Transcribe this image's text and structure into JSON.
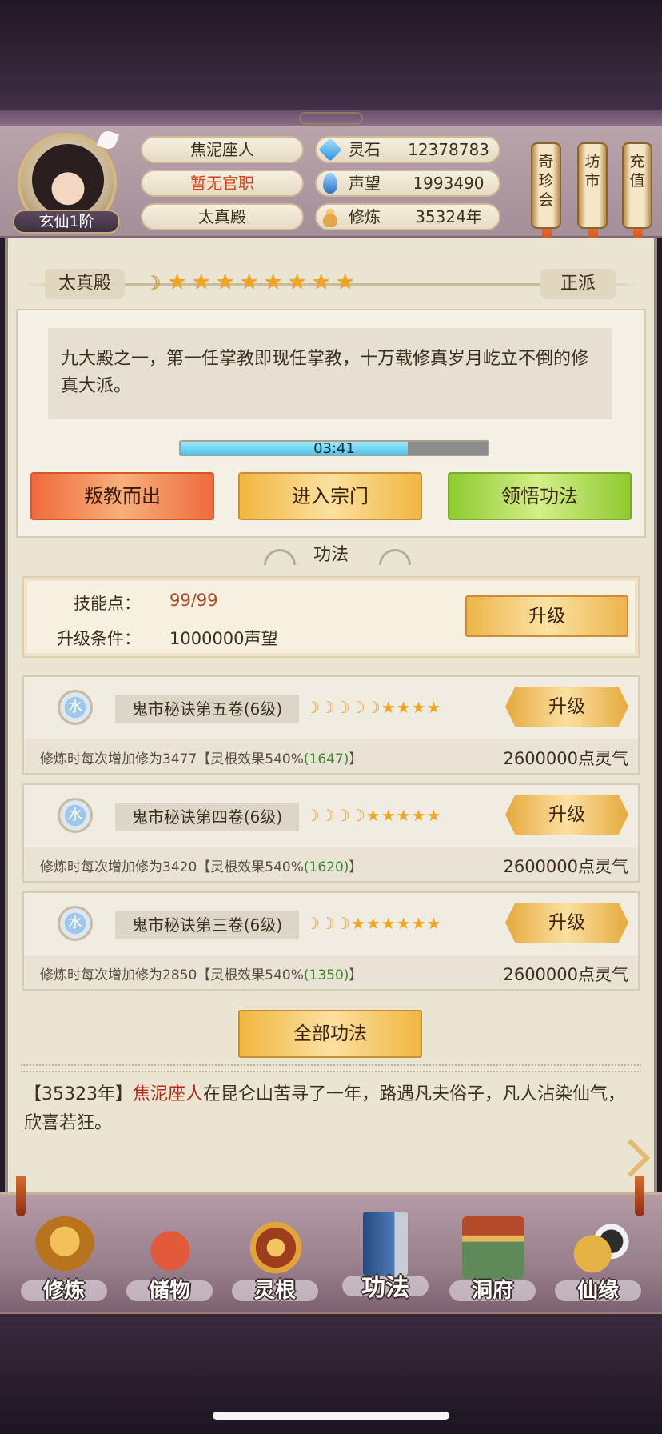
{
  "player": {
    "rank": "玄仙1阶",
    "name": "焦泥座人",
    "official_post": "暂无官职",
    "sect": "太真殿"
  },
  "resources": [
    {
      "icon": "spirit-stone-icon",
      "label": "灵石",
      "value": "12378783"
    },
    {
      "icon": "prestige-icon",
      "label": "声望",
      "value": "1993490"
    },
    {
      "icon": "cultivation-icon",
      "label": "修炼",
      "value": "35324年"
    }
  ],
  "side_menu": [
    {
      "label": "奇珍会"
    },
    {
      "label": "坊市"
    },
    {
      "label": "充值"
    }
  ],
  "sect_panel": {
    "name": "太真殿",
    "faction": "正派",
    "rating": {
      "moons": 1,
      "stars": 8
    },
    "description": "九大殿之一，第一任掌教即现任掌教，十万载修真岁月屹立不倒的修真大派。",
    "timer": "03:41",
    "timer_progress": 0.74,
    "actions": [
      "叛教而出",
      "进入宗门",
      "领悟功法"
    ]
  },
  "gongfa": {
    "section_title": "功法",
    "skill_points_label": "技能点：",
    "skill_points_value": "99/99",
    "upgrade_condition_label": "升级条件：",
    "upgrade_condition_value": "1000000声望",
    "upgrade_label": "升级",
    "skills": [
      {
        "element": "水",
        "name": "鬼市秘诀第五卷(6级)",
        "moons": 5,
        "stars": 4,
        "effect_prefix": "修炼时每次增加修为3477【灵根效果540%",
        "effect_bonus": "(1647)",
        "effect_suffix": "】",
        "cost": "2600000点灵气",
        "button": "升级"
      },
      {
        "element": "水",
        "name": "鬼市秘诀第四卷(6级)",
        "moons": 4,
        "stars": 5,
        "effect_prefix": "修炼时每次增加修为3420【灵根效果540%",
        "effect_bonus": "(1620)",
        "effect_suffix": "】",
        "cost": "2600000点灵气",
        "button": "升级"
      },
      {
        "element": "水",
        "name": "鬼市秘诀第三卷(6级)",
        "moons": 3,
        "stars": 6,
        "effect_prefix": "修炼时每次增加修为2850【灵根效果540%",
        "effect_bonus": "(1350)",
        "effect_suffix": "】",
        "cost": "2600000点灵气",
        "button": "升级"
      }
    ],
    "all_button": "全部功法"
  },
  "log": {
    "year": "【35323年】",
    "actor": "焦泥座人",
    "text": "在昆仑山苦寻了一年，路遇凡夫俗子，凡人沾染仙气，欣喜若狂。"
  },
  "bottom_nav": [
    {
      "label": "修炼",
      "icon": "cultivate-monk-icon"
    },
    {
      "label": "储物",
      "icon": "storage-bag-icon"
    },
    {
      "label": "灵根",
      "icon": "spirit-root-icon"
    },
    {
      "label": "功法",
      "icon": "technique-book-icon",
      "active": true
    },
    {
      "label": "洞府",
      "icon": "cave-dwelling-icon"
    },
    {
      "label": "仙缘",
      "icon": "immortal-fate-icon"
    }
  ]
}
